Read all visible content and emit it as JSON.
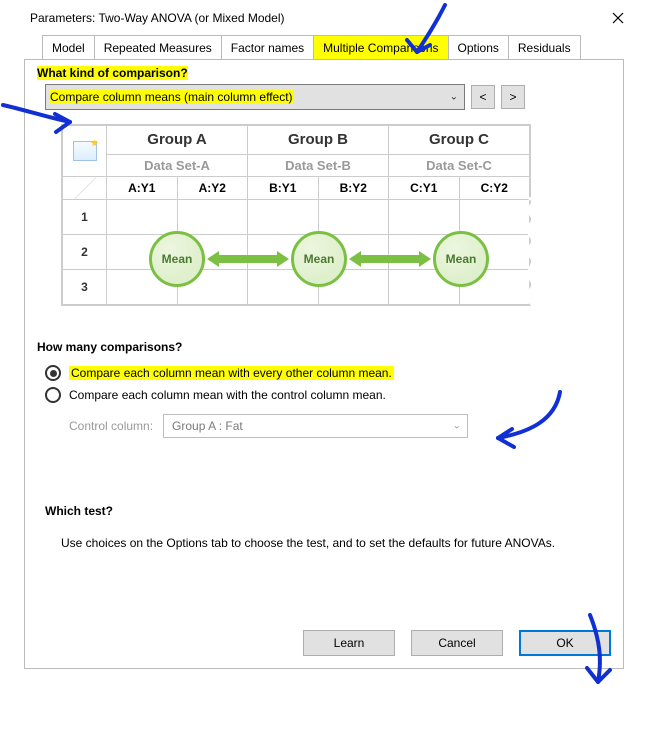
{
  "window": {
    "title": "Parameters: Two-Way ANOVA (or Mixed Model)"
  },
  "tabs": [
    {
      "label": "Model"
    },
    {
      "label": "Repeated Measures"
    },
    {
      "label": "Factor names"
    },
    {
      "label": "Multiple Comparisons"
    },
    {
      "label": "Options"
    },
    {
      "label": "Residuals"
    }
  ],
  "active_tab_index": 3,
  "comparison": {
    "heading": "What kind of comparison?",
    "dropdown_value": "Compare column means (main column effect)",
    "nav_prev": "<",
    "nav_next": ">"
  },
  "diagram": {
    "groups": [
      {
        "title": "Group A",
        "dataset": "Data Set-A",
        "sub": [
          "A:Y1",
          "A:Y2"
        ]
      },
      {
        "title": "Group B",
        "dataset": "Data Set-B",
        "sub": [
          "B:Y1",
          "B:Y2"
        ]
      },
      {
        "title": "Group C",
        "dataset": "Data Set-C",
        "sub": [
          "C:Y1",
          "C:Y2"
        ]
      }
    ],
    "rows": [
      "1",
      "2",
      "3"
    ],
    "mean_label": "Mean"
  },
  "how_many": {
    "heading": "How many comparisons?",
    "r1_label": "Compare each column mean with every other column mean.",
    "r2_label": "Compare each column mean with the control column mean.",
    "selected": 0,
    "control_label": "Control column:",
    "control_value": "Group A : Fat"
  },
  "which_test": {
    "heading": "Which test?",
    "text": "Use choices on the Options tab to choose the test, and to set the defaults for future ANOVAs."
  },
  "buttons": {
    "learn": "Learn",
    "cancel": "Cancel",
    "ok": "OK"
  }
}
